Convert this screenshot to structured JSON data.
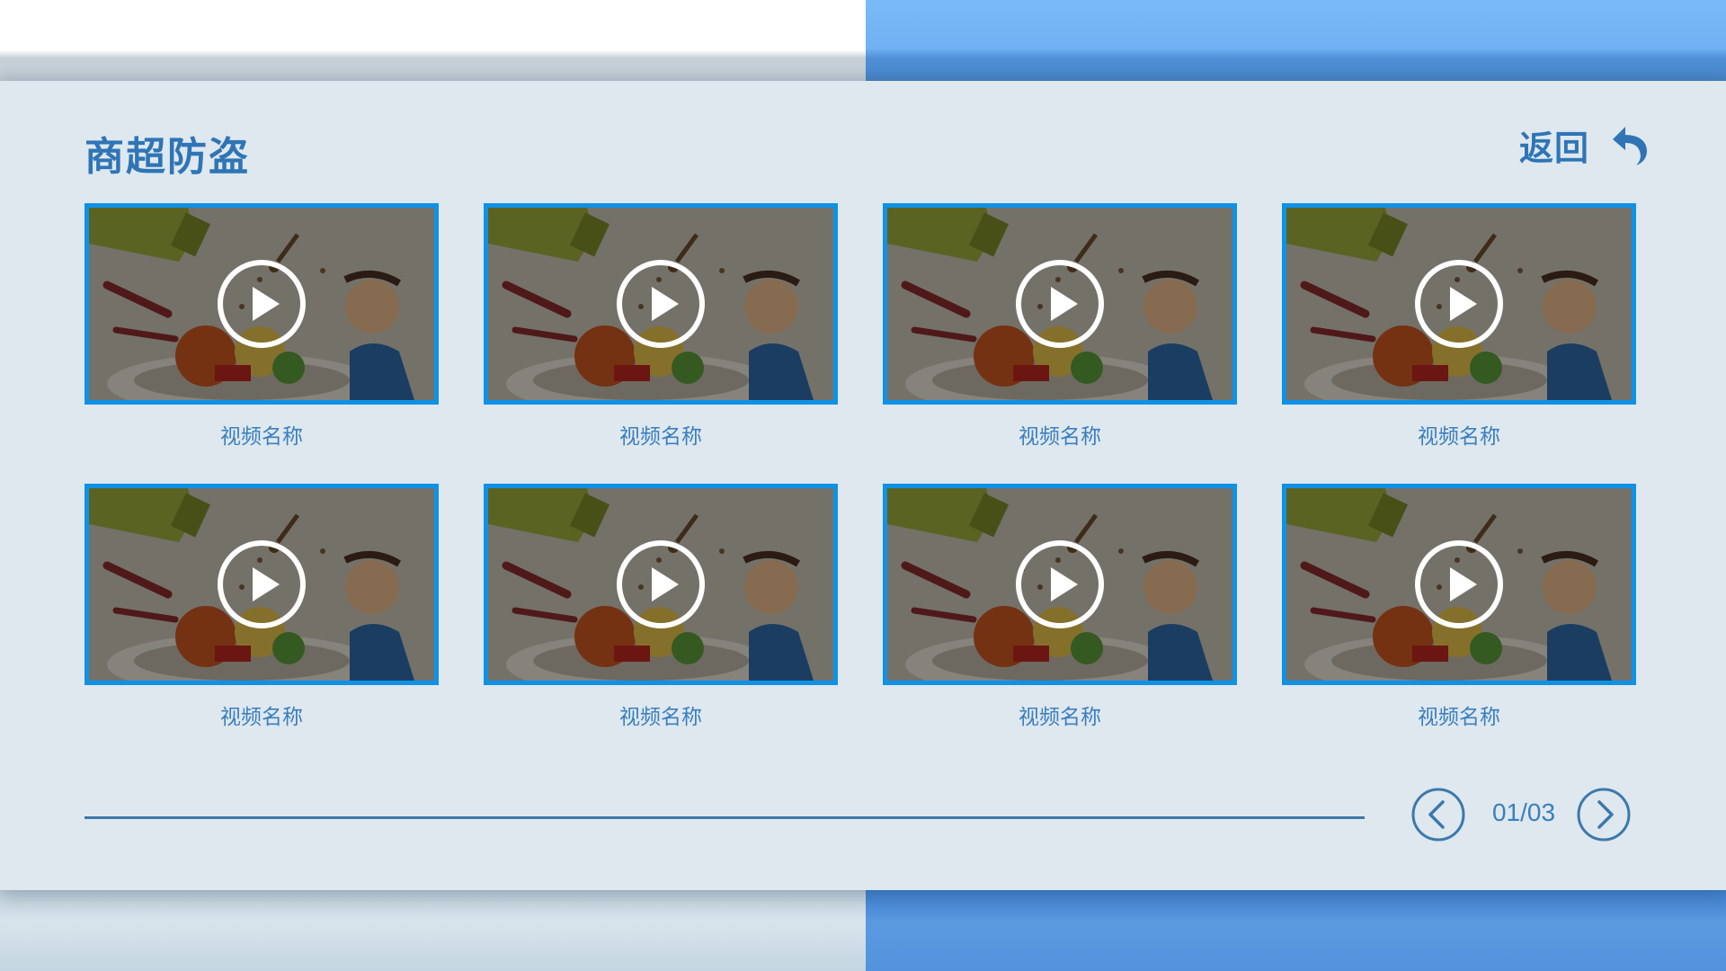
{
  "header": {
    "title": "商超防盗",
    "back_label": "返回",
    "back_icon": "undo-arrow-icon"
  },
  "videos": [
    {
      "title": "视频名称"
    },
    {
      "title": "视频名称"
    },
    {
      "title": "视频名称"
    },
    {
      "title": "视频名称"
    },
    {
      "title": "视频名称"
    },
    {
      "title": "视频名称"
    },
    {
      "title": "视频名称"
    },
    {
      "title": "视频名称"
    }
  ],
  "pagination": {
    "current": "01",
    "total": "03",
    "label": "01/03",
    "prev_icon": "chevron-left-icon",
    "next_icon": "chevron-right-icon"
  },
  "colors": {
    "accent": "#2f75b5",
    "thumb_border": "#0f92e6",
    "top_right_band": "#6fb1f2",
    "bottom_right_band": "#4a8bd8",
    "panel_bg": "#dfe8ef"
  }
}
